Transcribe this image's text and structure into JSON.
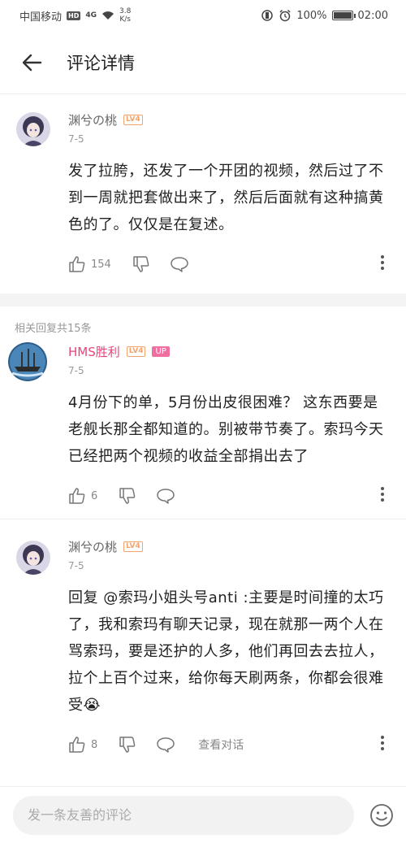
{
  "status_bar": {
    "carrier": "中国移动",
    "hd": "HD",
    "network": "4G",
    "speed_value": "3.8",
    "speed_unit": "K/s",
    "battery_pct": "100%",
    "battery_level": 1.0,
    "time": "02:00"
  },
  "header": {
    "title": "评论详情"
  },
  "main_comment": {
    "user": "渊兮の桃",
    "level": "LV4",
    "date": "7-5",
    "content": "发了拉胯，还发了一个开团的视频，然后过了不到一周就把套做出来了，然后后面就有这种搞黄色的了。仅仅是在复述。",
    "likes": "154"
  },
  "replies_header": "相关回复共15条",
  "replies": [
    {
      "user": "HMS胜利",
      "level": "LV4",
      "badge": "UP",
      "date": "7-5",
      "content": "4月份下的单，5月份出皮很困难？  这东西要是老舰长那全都知道的。别被带节奏了。索玛今天已经把两个视频的收益全部捐出去了",
      "likes": "6"
    },
    {
      "user": "渊兮の桃",
      "level": "LV4",
      "date": "7-5",
      "reply_prefix": "回复 ",
      "mention": "@索玛小姐头号anti",
      "content": " :主要是时间撞的太巧了，我和索玛有聊天记录，现在就那一两个人在骂索玛，要是还护的人多，他们再回去去拉人，拉个上百个过来，给你每天刷两条，你都会很难受",
      "emoji": "😭",
      "likes": "8",
      "view_dialog": "查看对话"
    }
  ],
  "bottom": {
    "placeholder": "发一条友善的评论"
  },
  "colors": {
    "vip_name": "#e6457a",
    "level_badge": "#f3a36c",
    "up_badge": "#f16fa0"
  }
}
